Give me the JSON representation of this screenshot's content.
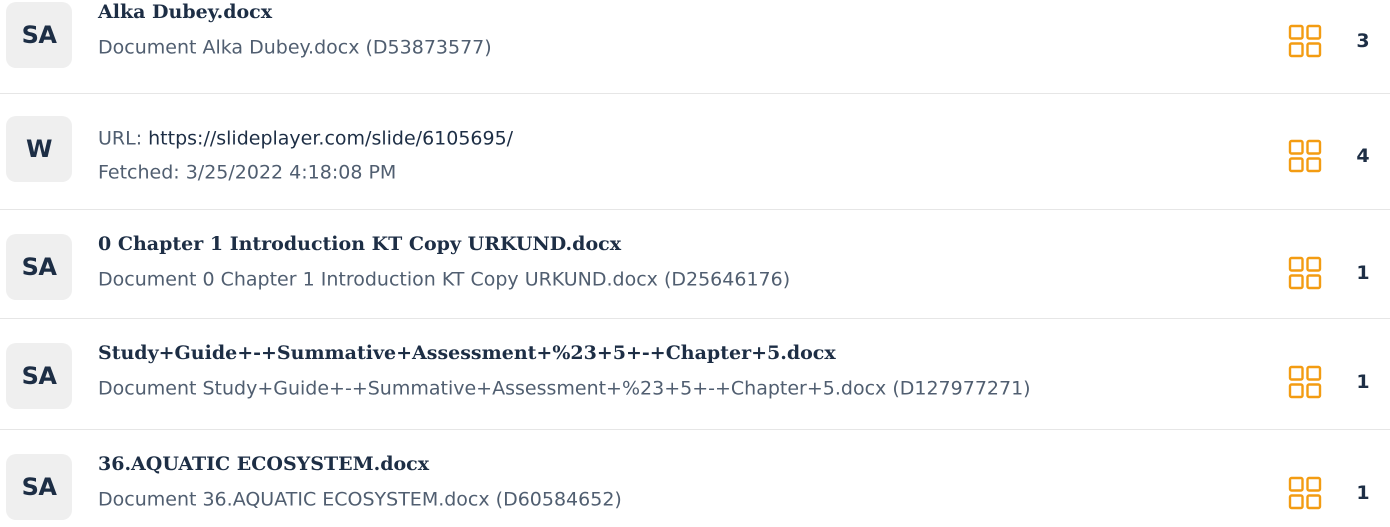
{
  "theme": {
    "text_dark": "#1d2e45",
    "text_muted": "#505e70",
    "badge_bg": "#efefef",
    "accent_orange": "#f39c12",
    "divider": "#e6e6e6"
  },
  "sources": [
    {
      "badge": "SA",
      "title": "Alka Dubey.docx",
      "subtitle": "Document Alka Dubey.docx (D53873577)",
      "icon": "grid-icon",
      "count": "3"
    },
    {
      "badge": "W",
      "url_prefix": "URL: ",
      "url": "https://slideplayer.com/slide/6105695/",
      "fetched": "Fetched: 3/25/2022 4:18:08 PM",
      "icon": "grid-icon",
      "count": "4"
    },
    {
      "badge": "SA",
      "title": "0 Chapter 1 Introduction KT Copy URKUND.docx",
      "subtitle": "Document 0 Chapter 1 Introduction KT Copy URKUND.docx (D25646176)",
      "icon": "grid-icon",
      "count": "1"
    },
    {
      "badge": "SA",
      "title": "Study+Guide+-+Summative+Assessment+%23+5+-+Chapter+5.docx",
      "subtitle": "Document Study+Guide+-+Summative+Assessment+%23+5+-+Chapter+5.docx (D127977271)",
      "icon": "grid-icon",
      "count": "1"
    },
    {
      "badge": "SA",
      "title": "36.AQUATIC ECOSYSTEM.docx",
      "subtitle": "Document 36.AQUATIC ECOSYSTEM.docx (D60584652)",
      "icon": "grid-icon",
      "count": "1"
    }
  ]
}
